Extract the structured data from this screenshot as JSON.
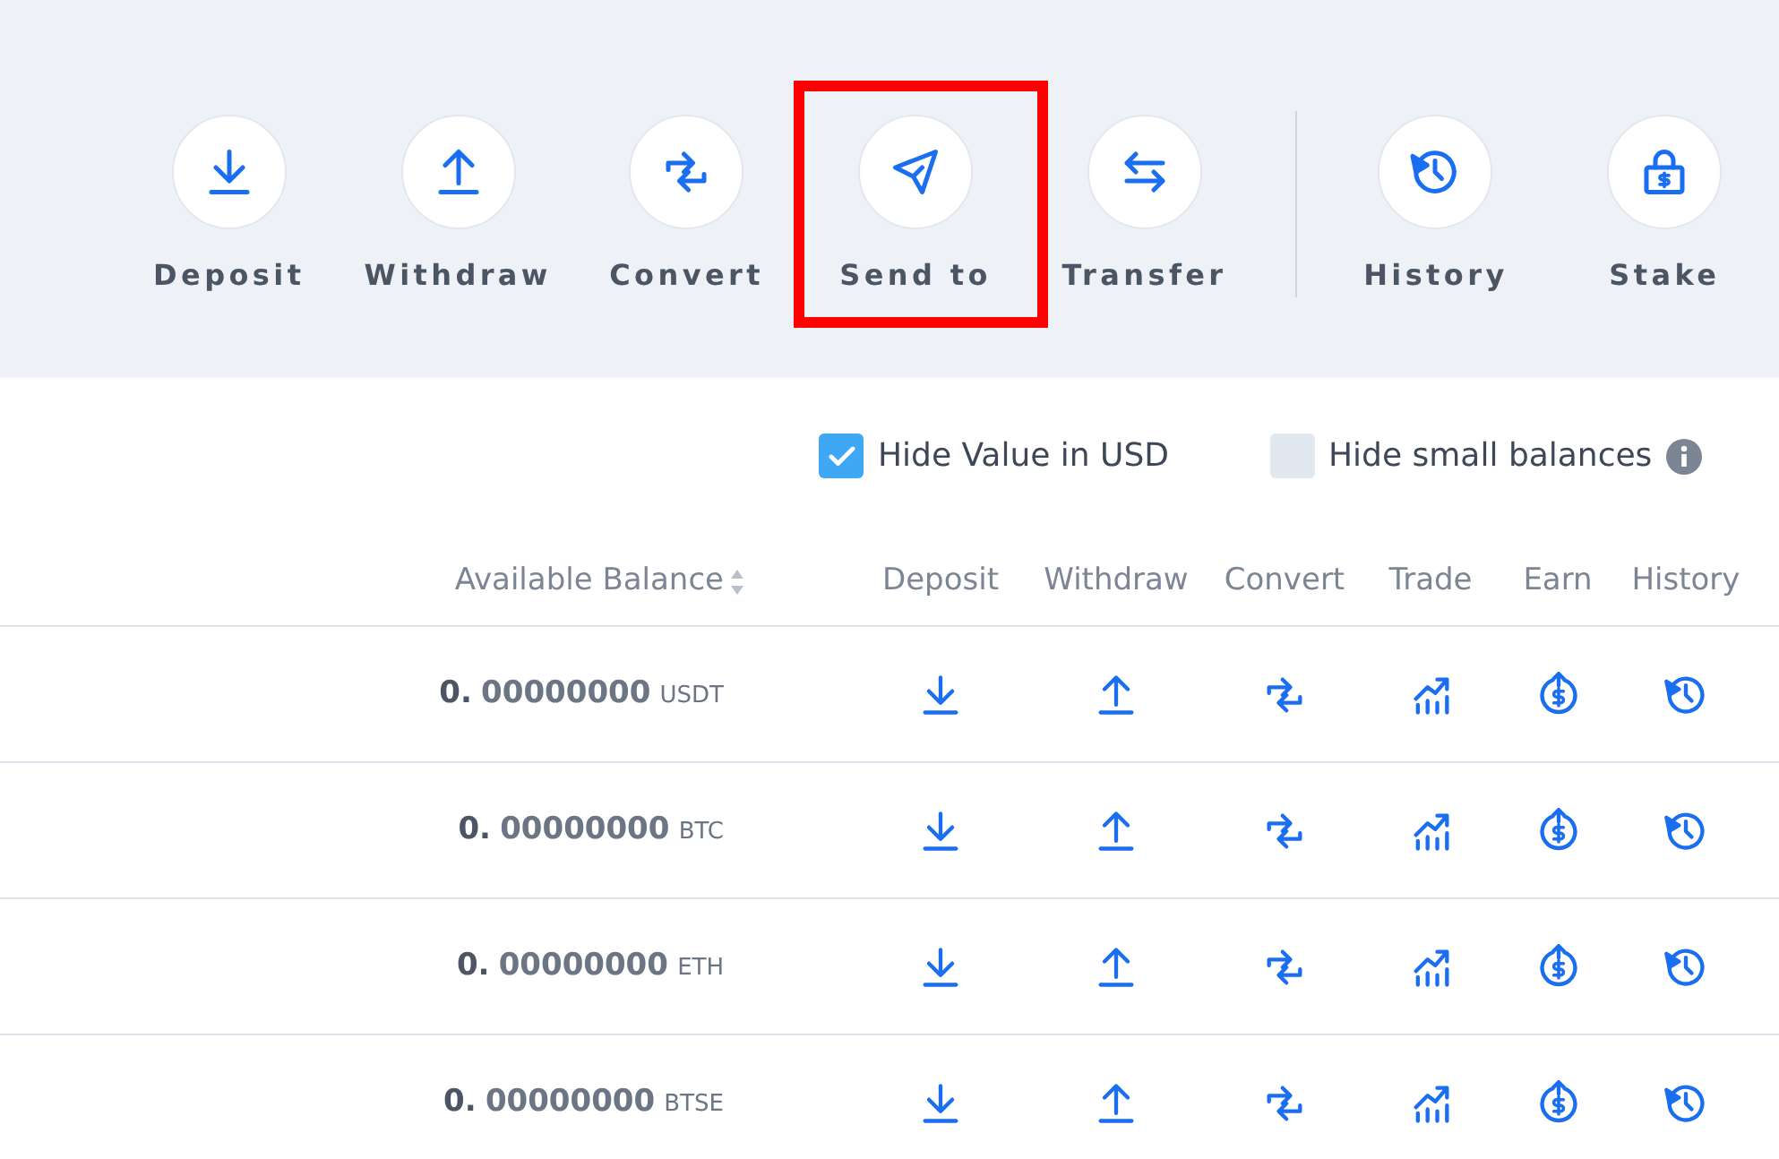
{
  "actions": [
    {
      "label": "Deposit",
      "kind": "deposit",
      "highlighted": false
    },
    {
      "label": "Withdraw",
      "kind": "withdraw",
      "highlighted": false
    },
    {
      "label": "Convert",
      "kind": "convert",
      "highlighted": false
    },
    {
      "label": "Send to",
      "kind": "send",
      "highlighted": true
    },
    {
      "label": "Transfer",
      "kind": "transfer",
      "highlighted": false
    },
    {
      "label": "History",
      "kind": "history",
      "highlighted": false,
      "separated": true
    },
    {
      "label": "Stake",
      "kind": "stake",
      "highlighted": false
    }
  ],
  "filters": [
    {
      "label": "Hide Value in USD",
      "checked": true,
      "info": false
    },
    {
      "label": "Hide small balances",
      "checked": false,
      "info": true
    }
  ],
  "table": {
    "columns": [
      {
        "label": "Available Balance",
        "kind": "balance",
        "sortable": true
      },
      {
        "label": "Deposit",
        "kind": "deposit"
      },
      {
        "label": "Withdraw",
        "kind": "withdraw"
      },
      {
        "label": "Convert",
        "kind": "convert"
      },
      {
        "label": "Trade",
        "kind": "trade"
      },
      {
        "label": "Earn",
        "kind": "earn"
      },
      {
        "label": "History",
        "kind": "history"
      }
    ],
    "rows": [
      {
        "amount": "0.",
        "decimals": "00000000",
        "currency": "USDT"
      },
      {
        "amount": "0.",
        "decimals": "00000000",
        "currency": "BTC"
      },
      {
        "amount": "0.",
        "decimals": "00000000",
        "currency": "ETH"
      },
      {
        "amount": "0.",
        "decimals": "00000000",
        "currency": "BTSE"
      }
    ]
  }
}
